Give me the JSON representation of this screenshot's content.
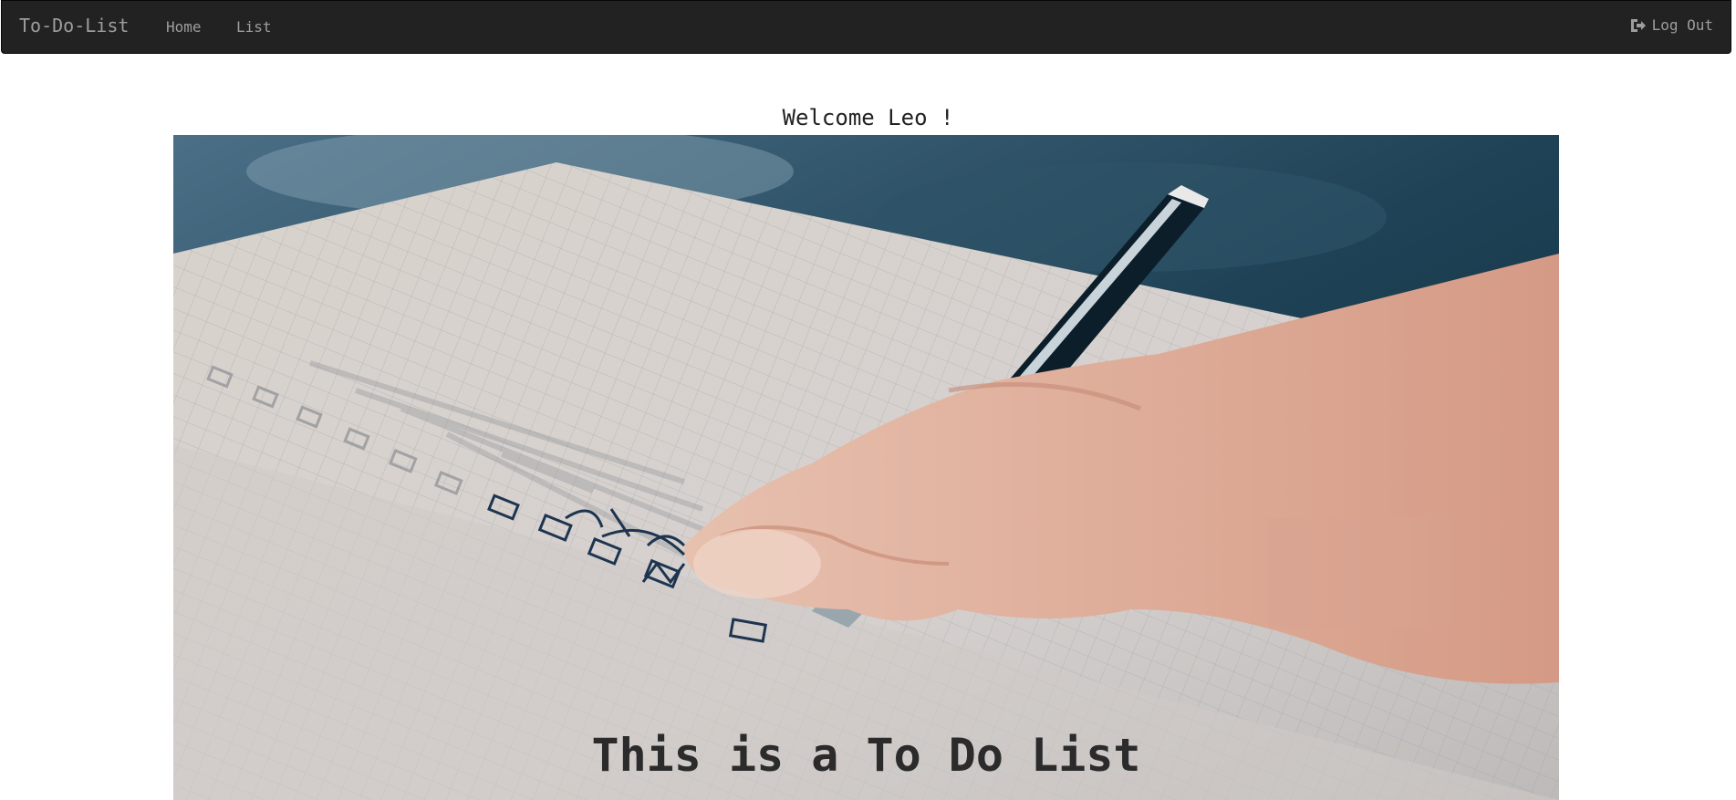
{
  "navbar": {
    "brand": "To-Do-List",
    "links": [
      {
        "label": "Home"
      },
      {
        "label": "List"
      }
    ],
    "logout_label": "Log Out",
    "logout_icon": "log-out-icon",
    "background": "#222222",
    "text_color": "#9d9d9d"
  },
  "main": {
    "welcome_text": "Welcome Leo !",
    "hero": {
      "image": "hand-writing-checklist-photo",
      "title": "This is a To Do List"
    }
  }
}
